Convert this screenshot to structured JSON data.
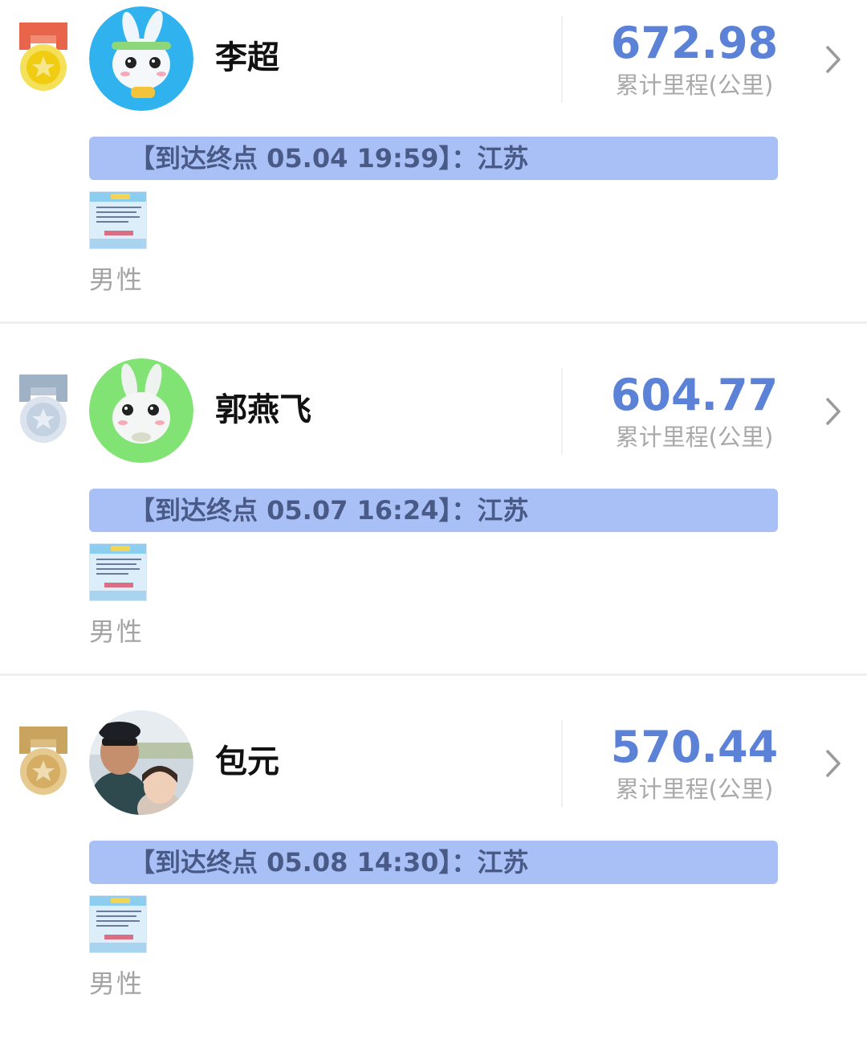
{
  "list": {
    "distance_label": "累计里程(公里)",
    "entries": [
      {
        "rank_medal": "gold-medal-icon",
        "name": "李超",
        "distance": "672.98",
        "arrival": "【到达终点 05.04 19:59】：江苏",
        "gender": "男性"
      },
      {
        "rank_medal": "silver-medal-icon",
        "name": "郭燕飞",
        "distance": "604.77",
        "arrival": "【到达终点 05.07 16:24】：江苏",
        "gender": "男性"
      },
      {
        "rank_medal": "bronze-medal-icon",
        "name": "包元",
        "distance": "570.44",
        "arrival": "【到达终点 05.08 14:30】：江苏",
        "gender": "男性"
      }
    ]
  },
  "colors": {
    "accent_blue": "#5b82d6",
    "arrival_bar": "#a9c0f7",
    "gold": "#f2d21a",
    "silver": "#c9d6e4",
    "bronze": "#d4ad62"
  }
}
